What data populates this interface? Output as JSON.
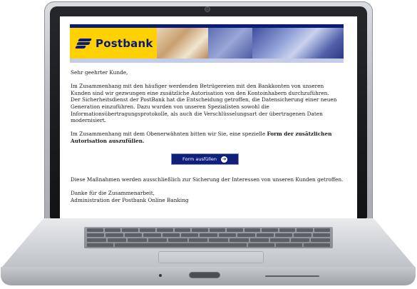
{
  "banner": {
    "brand_name": "Postbank",
    "brand_color": "#0b1a72",
    "accent_color": "#ffd100"
  },
  "email": {
    "greeting": "Sehr geehrter Kunde,",
    "paragraph1": "Im Zusammenhang mit den häufiger werdenden Betrügereien mit den Bankkonten von unseren Kunden sind wir gezwungen eine zusätzliche Autorisation von den Kontoinhabern durchzuführen.",
    "paragraph1_cont": "Der Sicherheitsdienst der PostBank hat die Entscheidung getroffen, die Datensicherung einer neuen Generation einzuführen. Dazu wurden von unseren Spezialisten sowohl die Informationsübertragungsprotokolle, als auch die Verschlüsselungsart der übertragenen Daten modernisiert.",
    "paragraph2_prefix": "Im Zusammenhang mit dem Obenerwähnten bitten wir Sie, eine spezielle ",
    "paragraph2_bold": "Form der zusätzlichen Autorisation auszufüllen.",
    "button_label": "Form ausfüllen",
    "button_arrow": "➔",
    "paragraph3": "Diese Maßnahmen werden ausschließlich zur Sicherung der Interessen von unseren Kunden getroffen.",
    "closing": "Danke für die Zusammenarbeit,",
    "signature": "Administration der Postbank Online Banking"
  }
}
